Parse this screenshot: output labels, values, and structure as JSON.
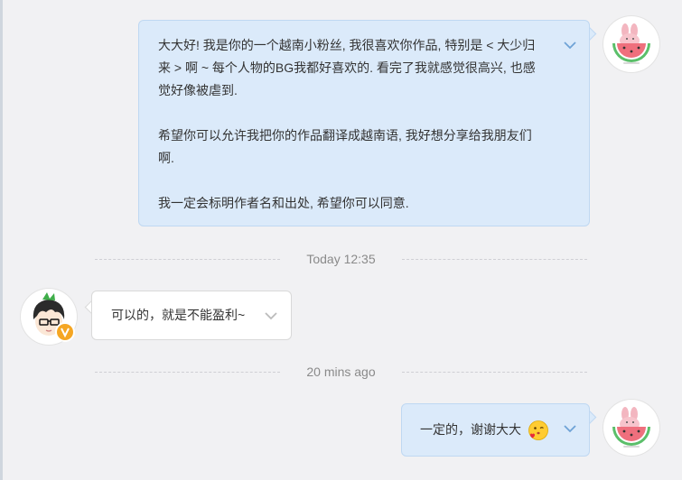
{
  "messages": [
    {
      "sender": "self",
      "paragraphs": [
        "大大好! 我是你的一个越南小粉丝, 我很喜欢你作品, 特别是 < 大少归来 > 啊 ~ 每个人物的BG我都好喜欢的. 看完了我就感觉很高兴, 也感觉好像被虐到.",
        "希望你可以允许我把你的作品翻译成越南语, 我好想分享给我朋友们啊.",
        "我一定会标明作者名和出处, 希望你可以同意."
      ]
    },
    {
      "sender": "other",
      "text": "可以的，就是不能盈利~"
    },
    {
      "sender": "self",
      "text": "一定的，谢谢大大",
      "emoji": "blowing-kiss-emoji"
    }
  ],
  "timestamps": [
    "Today 12:35",
    "20 mins ago"
  ],
  "colors": {
    "outgoing_bubble": "#dbeafa",
    "incoming_bubble": "#ffffff",
    "background": "#f1f1f3",
    "chevron": "#6fa3d6"
  },
  "icons": {
    "self_avatar": "watermelon-bunny-avatar",
    "other_avatar": "anime-boy-avatar",
    "verified_badge": "v-badge-icon",
    "dropdown": "chevron-down-icon"
  }
}
